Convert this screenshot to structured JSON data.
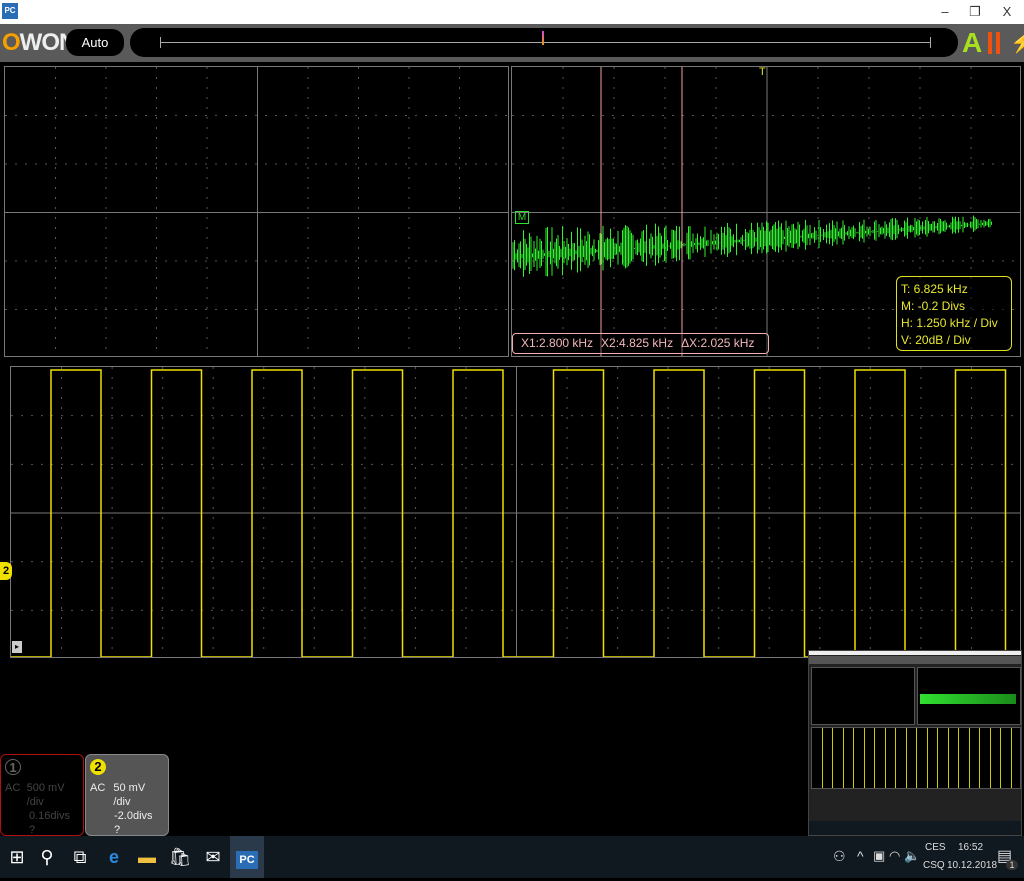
{
  "app": {
    "icon_label": "PC",
    "logo": {
      "o": "O",
      "rest": "WON"
    },
    "mode_button": "Auto",
    "window_controls": {
      "minimize": "–",
      "maximize": "❐",
      "close": "X"
    },
    "run_state": "A",
    "accent": "#f5a000"
  },
  "fft": {
    "cursors": {
      "x1": "X1:2.800 kHz",
      "x2": "X2:4.825 kHz",
      "dx": "ΔX:2.025 kHz"
    },
    "info": {
      "t": "T: 6.825 kHz",
      "m": "M: -0.2 Divs",
      "h": "H: 1.250 kHz / Div",
      "v": "V: 20dB  / Div"
    },
    "marker": "M",
    "trigger_marker": "T",
    "color": "#30f030"
  },
  "waveform": {
    "channel_marker": "2",
    "color": "#f0e000"
  },
  "channels": [
    {
      "num": "1",
      "coupling": "AC",
      "scale": "500 mV /div",
      "offset": "0.16divs",
      "probe": "?",
      "active": false
    },
    {
      "num": "2",
      "coupling": "AC",
      "scale": "50 mV /div",
      "offset": "-2.0divs",
      "probe": "?",
      "active": true
    }
  ],
  "taskbar": {
    "items": [
      "windows-start",
      "search",
      "task-view",
      "edge",
      "file-explorer",
      "store",
      "mail",
      "pc-oscilloscope"
    ],
    "tray": {
      "lang_top": "CES",
      "lang_bottom": "CSQ",
      "time": "16:52",
      "date": "10.12.2018",
      "notifications": "1"
    }
  }
}
